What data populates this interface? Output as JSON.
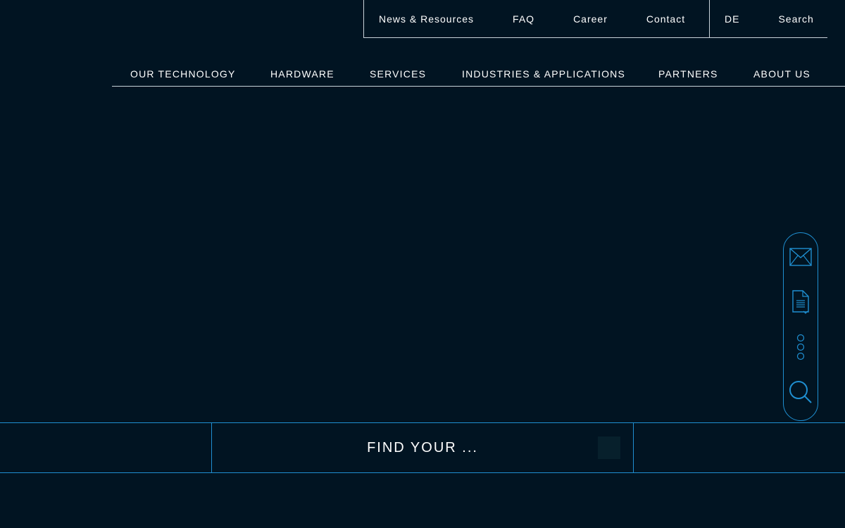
{
  "top_nav": {
    "news": "News & Resources",
    "faq": "FAQ",
    "career": "Career",
    "contact": "Contact",
    "language": "DE",
    "search": "Search"
  },
  "main_nav": {
    "items": [
      "OUR TECHNOLOGY",
      "HARDWARE",
      "SERVICES",
      "INDUSTRIES & APPLICATIONS",
      "PARTNERS",
      "ABOUT US"
    ]
  },
  "side_widget": {
    "icons": [
      "mail-icon",
      "document-download-icon",
      "steps-icon",
      "search-icon"
    ]
  },
  "find_bar": {
    "label": "FIND YOUR ..."
  },
  "colors": {
    "background": "#011422",
    "accent": "#1f8fd1",
    "text": "#ffffff",
    "divider": "#c8d3da"
  }
}
